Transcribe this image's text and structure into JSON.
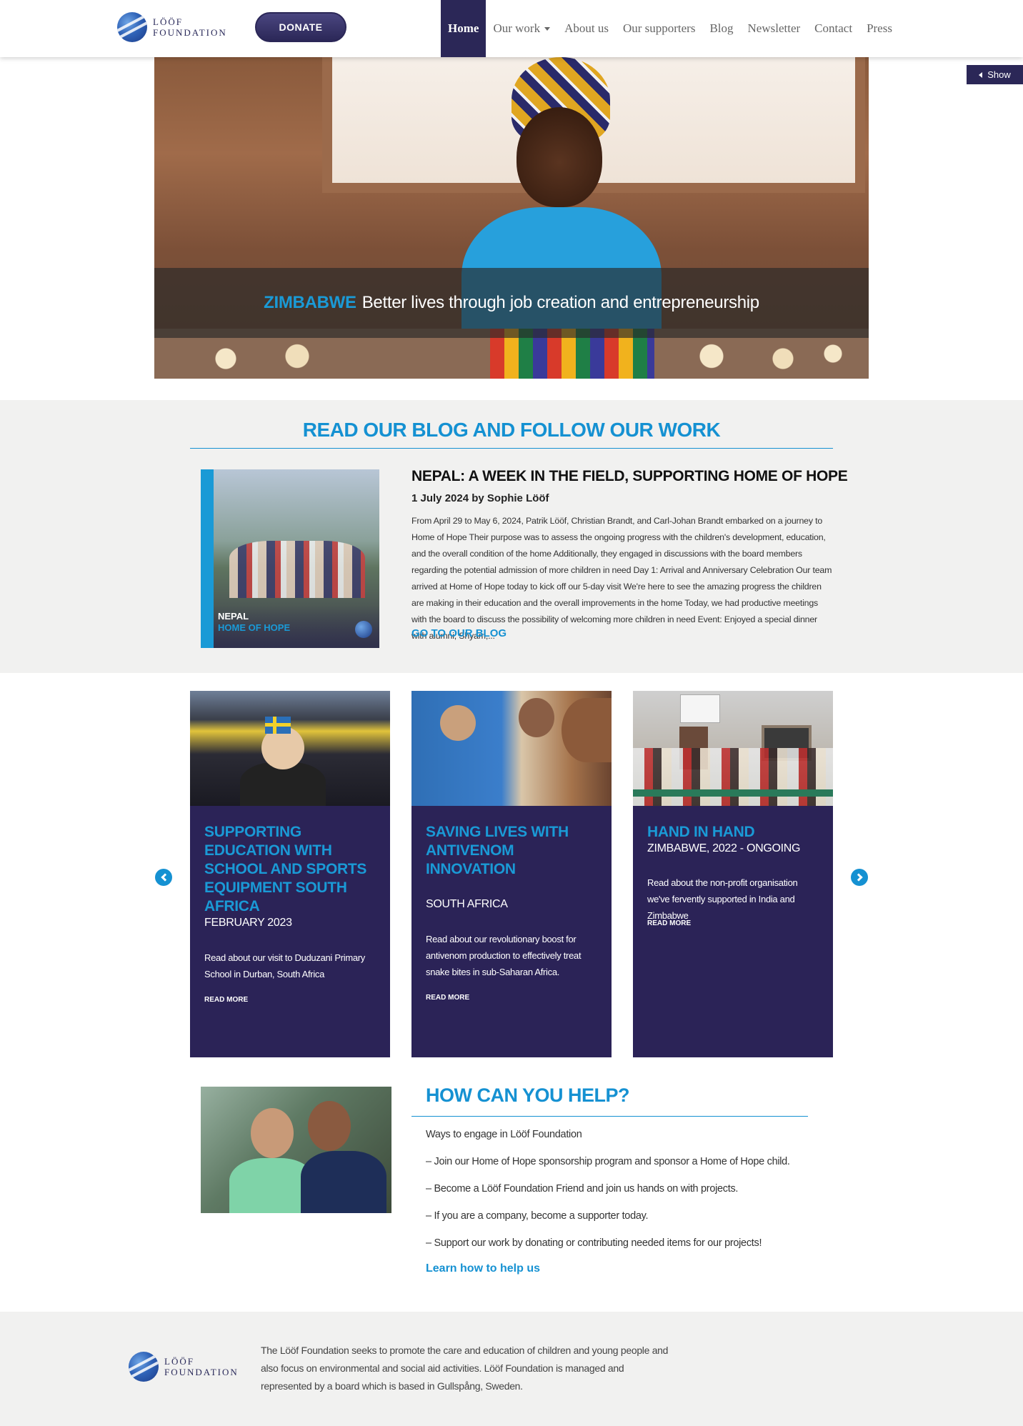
{
  "header": {
    "logo_line1": "LÖÖF",
    "logo_line2": "FOUNDATION",
    "donate_label": "DONATE",
    "nav": [
      {
        "label": "Home"
      },
      {
        "label": "Our work"
      },
      {
        "label": "About us"
      },
      {
        "label": "Our supporters"
      },
      {
        "label": "Blog"
      },
      {
        "label": "Newsletter"
      },
      {
        "label": "Contact"
      },
      {
        "label": "Press"
      }
    ],
    "show_label": "Show"
  },
  "hero": {
    "country": "ZIMBABWE",
    "caption": "Better lives through job creation and entrepreneurship"
  },
  "blog": {
    "section_title": "READ OUR BLOG AND FOLLOW OUR WORK",
    "image_label_line1": "NEPAL",
    "image_label_line2": "HOME OF HOPE",
    "post_title": "NEPAL: A WEEK IN THE FIELD, SUPPORTING HOME OF HOPE",
    "post_meta": "1 July 2024 by Sophie Lööf",
    "post_excerpt": "From April 29 to May 6, 2024, Patrik Lööf, Christian Brandt, and Carl-Johan Brandt embarked on a journey to Home of Hope Their purpose was to assess the ongoing progress with the children's development, education, and the overall condition of the home Additionally, they engaged in discussions with the board members regarding the potential admission of more children in need Day 1: Arrival and Anniversary Celebration Our team arrived at Home of Hope today to kick off our 5-day visit We're here to see the amazing progress the children are making in their education and the overall improvements in the home Today, we had productive meetings with the board to discuss the possibility of welcoming more children in need Event: Enjoyed a special dinner with alumni, Shyam,...",
    "go_label": "GO TO OUR BLOG"
  },
  "projects": [
    {
      "title": "SUPPORTING EDUCATION WITH SCHOOL AND SPORTS EQUIPMENT SOUTH AFRICA",
      "subtitle": "FEBRUARY 2023",
      "description": "Read about our visit to Duduzani Primary School in Durban, South Africa",
      "more": "READ MORE"
    },
    {
      "title": "SAVING LIVES WITH ANTIVENOM INNOVATION",
      "subtitle": "SOUTH AFRICA",
      "description": "Read about our revolutionary boost for antivenom production to effectively treat snake bites in sub-Saharan Africa.",
      "more": "READ MORE"
    },
    {
      "title": "HAND IN HAND",
      "subtitle": "ZIMBABWE, 2022 - ONGOING",
      "description": "Read about the non-profit organisation we've fervently supported in India and Zimbabwe",
      "more": "READ MORE"
    }
  ],
  "help": {
    "title": "HOW CAN YOU HELP?",
    "items": [
      "Ways to engage in Lööf Foundation",
      "– Join our Home of Hope sponsorship program and sponsor a Home of Hope child.",
      "– Become a Lööf Foundation Friend and join us hands on with projects.",
      "– If you are a company, become a supporter today.",
      "– Support our work by donating or contributing needed items for our projects!"
    ],
    "link": "Learn how to help us"
  },
  "footer": {
    "text": "The Lööf Foundation seeks to promote the care and education of children and young people and also focus on environmental and social aid activities. Lööf Foundation is managed and represented by a board which is based in Gullspång, Sweden."
  },
  "colors": {
    "navy": "#2b2757",
    "accent_blue": "#1591d2",
    "card_bg": "#2b2357",
    "band_bg": "#f1f1f0"
  }
}
